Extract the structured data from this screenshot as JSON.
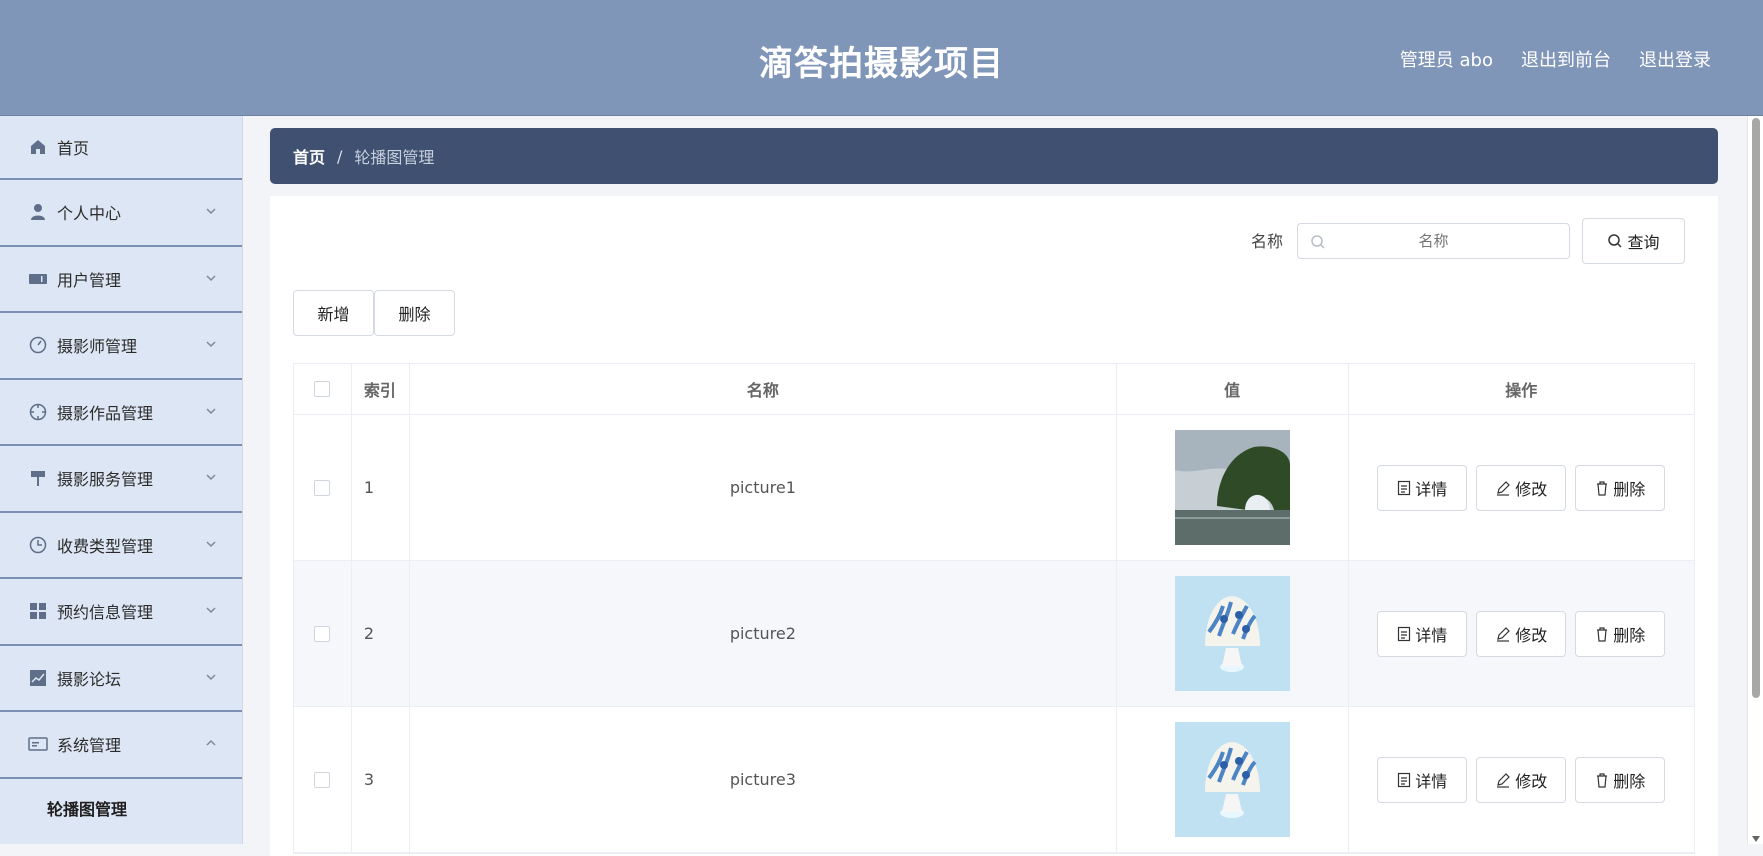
{
  "header": {
    "title": "滴答拍摄影项目",
    "user": "管理员 abo",
    "back_to_front": "退出到前台",
    "logout": "退出登录"
  },
  "sidebar": {
    "items": [
      {
        "label": "首页",
        "icon": "home-icon",
        "expanded": false
      },
      {
        "label": "个人中心",
        "icon": "user-icon",
        "expanded": false
      },
      {
        "label": "用户管理",
        "icon": "ticket-icon",
        "expanded": false
      },
      {
        "label": "摄影师管理",
        "icon": "gauge-icon",
        "expanded": false
      },
      {
        "label": "摄影作品管理",
        "icon": "target-icon",
        "expanded": false
      },
      {
        "label": "摄影服务管理",
        "icon": "paint-roller-icon",
        "expanded": false
      },
      {
        "label": "收费类型管理",
        "icon": "clock-icon",
        "expanded": false
      },
      {
        "label": "预约信息管理",
        "icon": "grid-icon",
        "expanded": false
      },
      {
        "label": "摄影论坛",
        "icon": "chart-icon",
        "expanded": false
      },
      {
        "label": "系统管理",
        "icon": "card-icon",
        "expanded": true
      }
    ],
    "sub_item": "轮播图管理"
  },
  "breadcrumb": {
    "home": "首页",
    "separator": "/",
    "current": "轮播图管理"
  },
  "search": {
    "label": "名称",
    "placeholder": "名称",
    "query_label": "查询"
  },
  "actions": {
    "add_label": "新增",
    "delete_label": "删除"
  },
  "table": {
    "headers": [
      "索引",
      "名称",
      "值",
      "操作"
    ],
    "rows": [
      {
        "index": "1",
        "name": "picture1",
        "image": "elephant-trunk-hill-photo"
      },
      {
        "index": "2",
        "name": "picture2",
        "image": "blue-white-dessert-photo"
      },
      {
        "index": "3",
        "name": "picture3",
        "image": "blue-white-dessert-photo"
      }
    ],
    "row_buttons": {
      "detail": "详情",
      "edit": "修改",
      "delete": "删除"
    }
  },
  "colors": {
    "header": "#8096b9",
    "sidebar": "#dde6f4",
    "breadcrumb": "#3f5071"
  }
}
